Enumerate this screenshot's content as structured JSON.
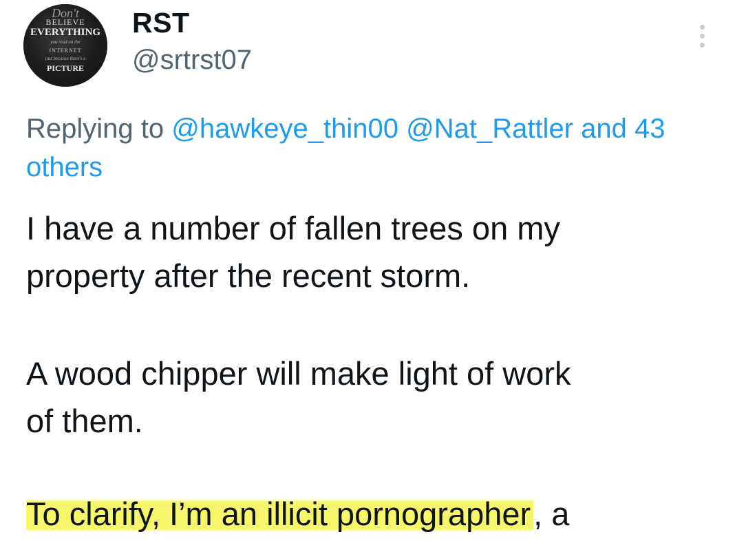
{
  "tweet": {
    "author": {
      "display_name": "RST",
      "handle": "@srtrst07",
      "avatar_text": [
        "Don't",
        "BELIEVE",
        "EVERYTHING",
        "you read on the",
        "INTERNET",
        "just because there's a",
        "PICTURE"
      ]
    },
    "replying": {
      "prefix": "Replying to",
      "mentions": [
        "@hawkeye_thin00",
        "@Nat_Rattler"
      ],
      "and_text": "and 43",
      "others": "others"
    },
    "body": {
      "para1_line1": "I have a number of fallen trees on my",
      "para1_line2": "property after the recent storm.",
      "para2_line1": "A wood chipper will make light of work",
      "para2_line2": "of them.",
      "para3_highlighted": "To clarify, I’m an illicit pornographer",
      "para3_tail": ", a"
    },
    "highlight_color": "#f5f550",
    "link_color": "#1d9bf0"
  }
}
